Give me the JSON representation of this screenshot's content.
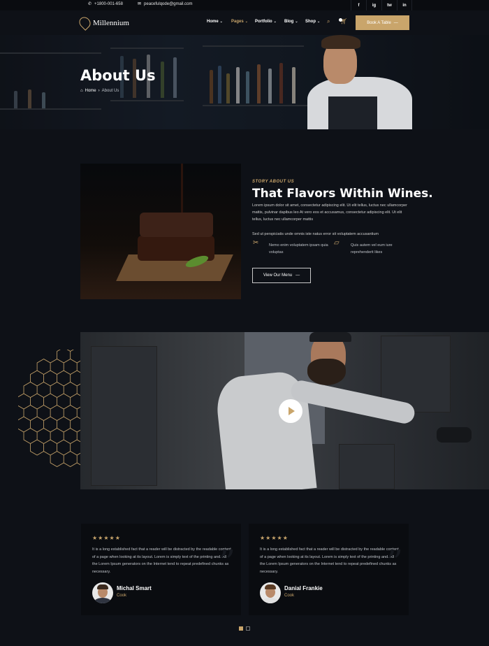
{
  "topbar": {
    "phone": "+1800-001-658",
    "email": "peacefulqode@gmail.com",
    "social": [
      "f",
      "ig",
      "tw",
      "in"
    ]
  },
  "nav": {
    "brand": "Millennium",
    "items": [
      {
        "label": "Home",
        "chevron": "⌄"
      },
      {
        "label": "Pages",
        "chevron": "⌄"
      },
      {
        "label": "Portfolio",
        "chevron": "⌄"
      },
      {
        "label": "Blog",
        "chevron": "⌄"
      },
      {
        "label": "Shop",
        "chevron": "⌄"
      }
    ],
    "active_item": "Pages",
    "cta_label": "Book A Table",
    "icons": [
      "search-icon",
      "cart-icon"
    ]
  },
  "hero": {
    "title": "About Us",
    "breadcrumb": {
      "home": "Home",
      "current": "About Us"
    }
  },
  "story": {
    "eyebrow": "STORY ABOUT US",
    "title": "That Flavors Within Wines.",
    "paragraph1": "Lorem ipsum dolor sit amet, consectetur adipiscing elit. Ut elit tellus, luctus nec ullamcorper mattis, pulvinar dapibus leo At vero eos et accusamus, consectetur adipiscing elit. Ut elit tellus, luctus nec ullamcorper mattis",
    "paragraph2": "Sed ut perspiciatis unde omnis iste natus error sit voluptatem accusantium",
    "features": [
      {
        "icon": "knife-fork-icon",
        "text": "Nemo enim voluptatem ipsam quia voluptas"
      },
      {
        "icon": "ticket-icon",
        "text": "Quis autem vel eum iure reprehenderit likes"
      }
    ],
    "button_label": "View Our Menu"
  },
  "testimonials": [
    {
      "stars": "★★★★★",
      "quote": "It is a long established fact that a reader will be distracted by the readable content of a page when looking at its layout. Lorem is simply text of the printing and. All the Lorem Ipsum generators on the Internet tend to repeat predefined chunks as necessary.",
      "name": "Michal Smart",
      "role": "Cook"
    },
    {
      "stars": "★★★★★",
      "quote": "It is a long established fact that a reader will be distracted by the readable content of a page when looking at its layout. Lorem is simply text of the printing and. All the Lorem Ipsum generators on the Internet tend to repeat predefined chunks as necessary.",
      "name": "Danial Frankie",
      "role": "Cook"
    }
  ],
  "slider": {
    "count": 2,
    "active": 1
  },
  "colors": {
    "accent": "#c9a56b",
    "background": "#0e1117",
    "card": "#0a0c10"
  }
}
